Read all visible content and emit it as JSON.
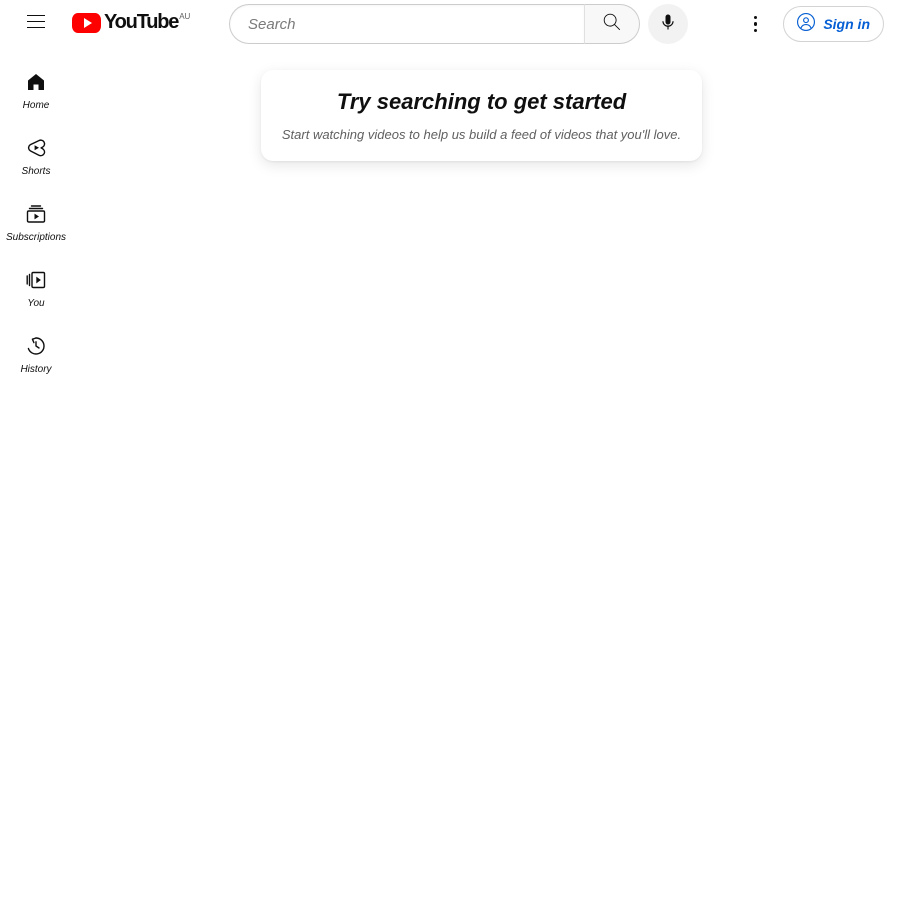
{
  "header": {
    "menu_icon": "hamburger-menu-icon",
    "logo": {
      "wordmark": "YouTube",
      "country_code": "AU",
      "play_icon": "youtube-play-icon",
      "brand_color": "#ff0000"
    },
    "search": {
      "placeholder": "Search",
      "value": "",
      "search_icon": "search-icon",
      "mic_icon": "microphone-icon"
    },
    "settings_icon": "kebab-menu-icon",
    "sign_in": {
      "label": "Sign in",
      "icon": "account-circle-icon",
      "accent_color": "#065fd4"
    }
  },
  "sidebar": {
    "items": [
      {
        "label": "Home",
        "icon": "home-icon"
      },
      {
        "label": "Shorts",
        "icon": "shorts-icon"
      },
      {
        "label": "Subscriptions",
        "icon": "subscriptions-icon"
      },
      {
        "label": "You",
        "icon": "you-library-icon"
      },
      {
        "label": "History",
        "icon": "history-clock-icon"
      }
    ]
  },
  "main": {
    "promo_card": {
      "title": "Try searching to get started",
      "subtitle": "Start watching videos to help us build a feed of videos that you'll love."
    }
  }
}
